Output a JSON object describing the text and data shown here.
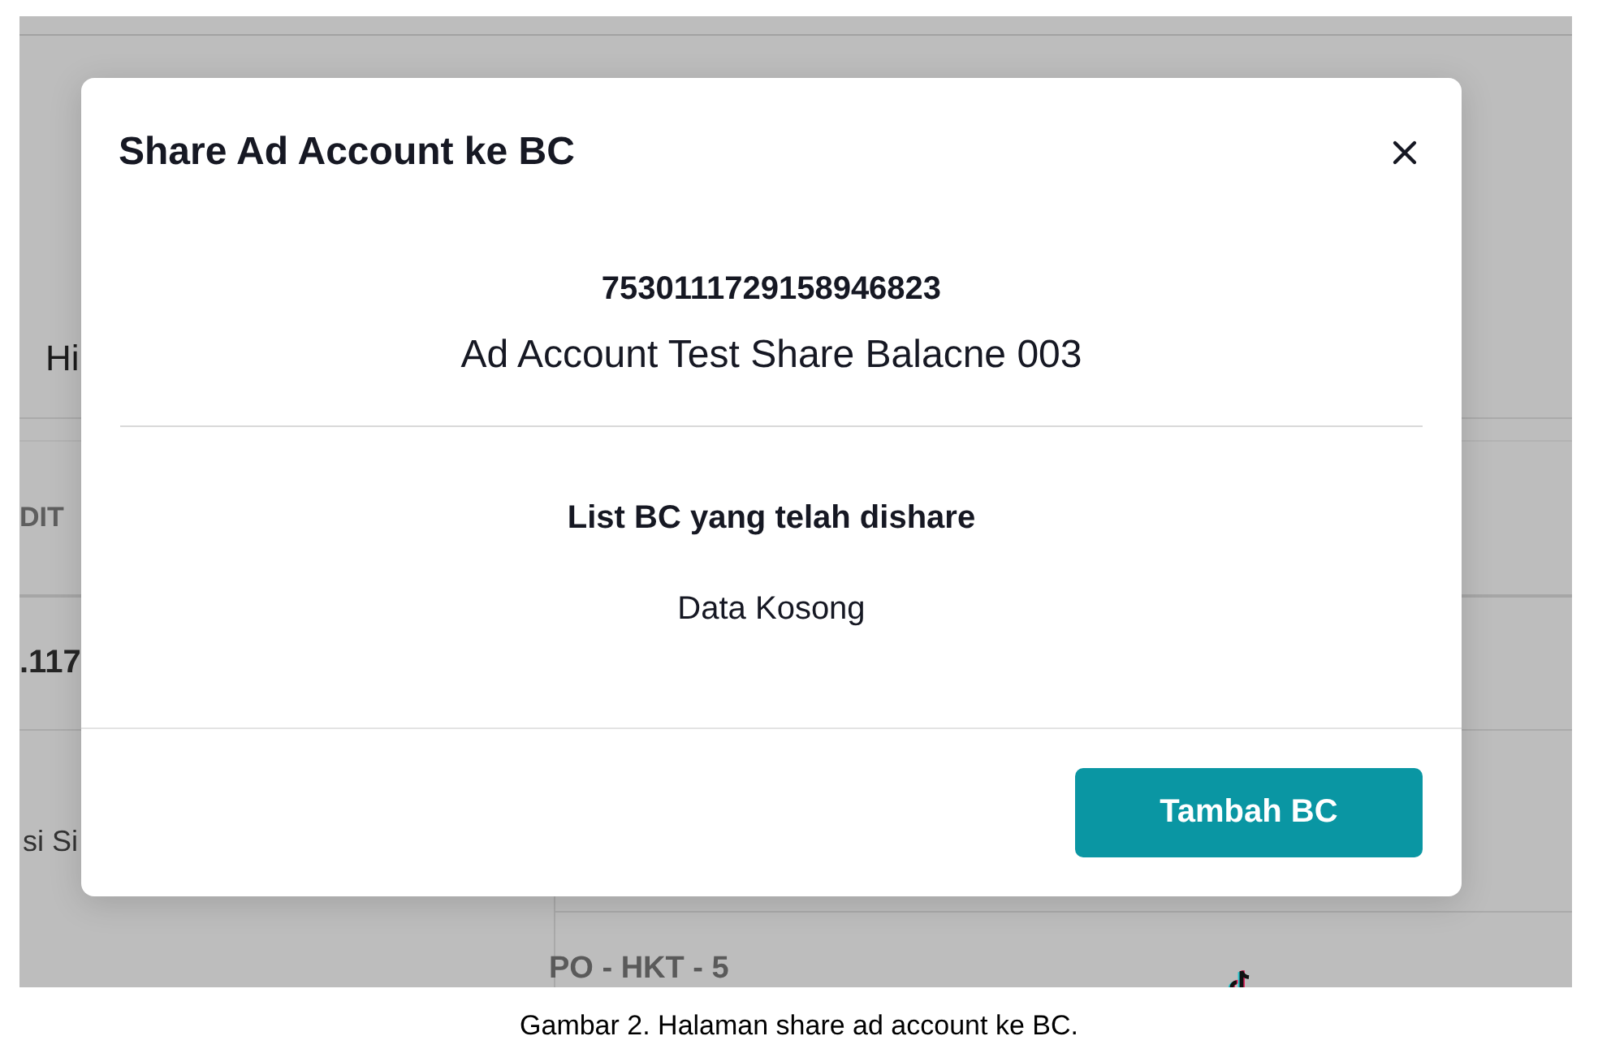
{
  "background_page": {
    "heading": "Hi",
    "column_header": "DIT",
    "rows": [
      {
        "cell": ".117"
      },
      {
        "cell": "si Si"
      }
    ],
    "campaign": "PO - HKT - 5"
  },
  "dialog": {
    "title": "Share Ad Account ke BC",
    "account_id": "7530111729158946823",
    "account_name": "Ad Account Test Share Balacne 003",
    "shared_list_title": "List BC yang telah dishare",
    "empty_text": "Data Kosong",
    "buttons": [
      "Tambah BC"
    ]
  },
  "caption": "Gambar 2. Halaman share ad account ke BC."
}
